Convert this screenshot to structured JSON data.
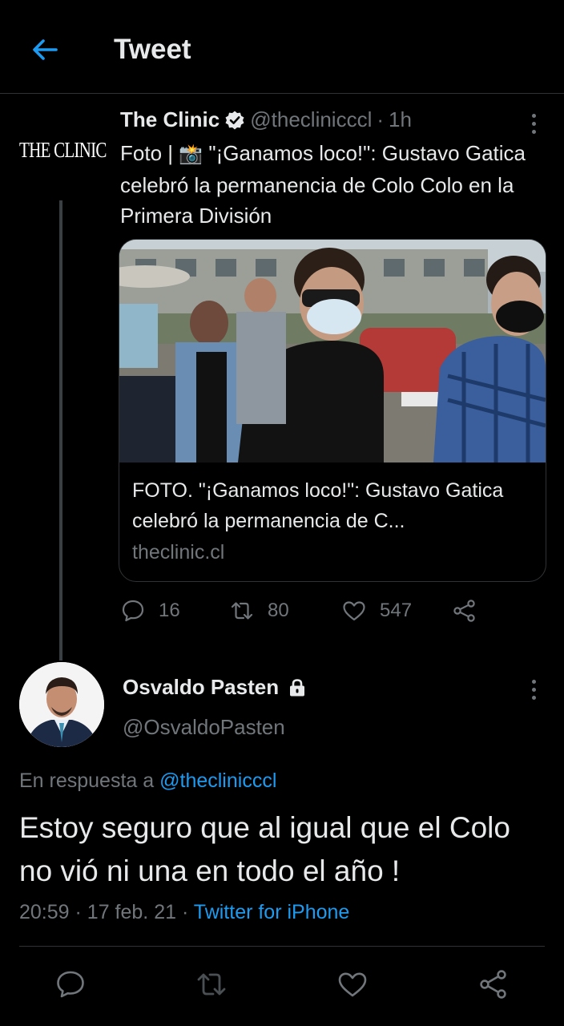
{
  "header": {
    "title": "Tweet",
    "back_icon": "arrow-left-icon"
  },
  "colors": {
    "accent": "#1d9bf0",
    "muted": "#71767b",
    "background": "#000000"
  },
  "parent_tweet": {
    "logo_text": "THE CLINIC",
    "name": "The Clinic",
    "handle": "@theclinicccl",
    "separator": "·",
    "time": "1h",
    "text_prefix": "Foto |",
    "text_emoji": "📸",
    "text_body": "\"¡Ganamos loco!\": Gustavo Gatica celebró la permanencia de Colo Colo en la Primera División",
    "card": {
      "title": "FOTO. \"¡Ganamos loco!\": Gustavo Gatica celebró la permanencia de C...",
      "domain": "theclinic.cl",
      "image_alt": "Gustavo Gatica con mascarilla y lentes oscuros junto a otras personas en la calle"
    },
    "stats": {
      "replies": "16",
      "retweets": "80",
      "likes": "547"
    }
  },
  "reply_tweet": {
    "name": "Osvaldo Pasten",
    "handle": "@OsvaldoPasten",
    "replying_label": "En respuesta a",
    "replying_to": "@theclinicccl",
    "text": "Estoy seguro que al igual que el Colo no vió ni una en todo el año !",
    "time": "20:59",
    "sep1": "·",
    "date": "17 feb. 21",
    "sep2": "·",
    "source": "Twitter for iPhone"
  }
}
